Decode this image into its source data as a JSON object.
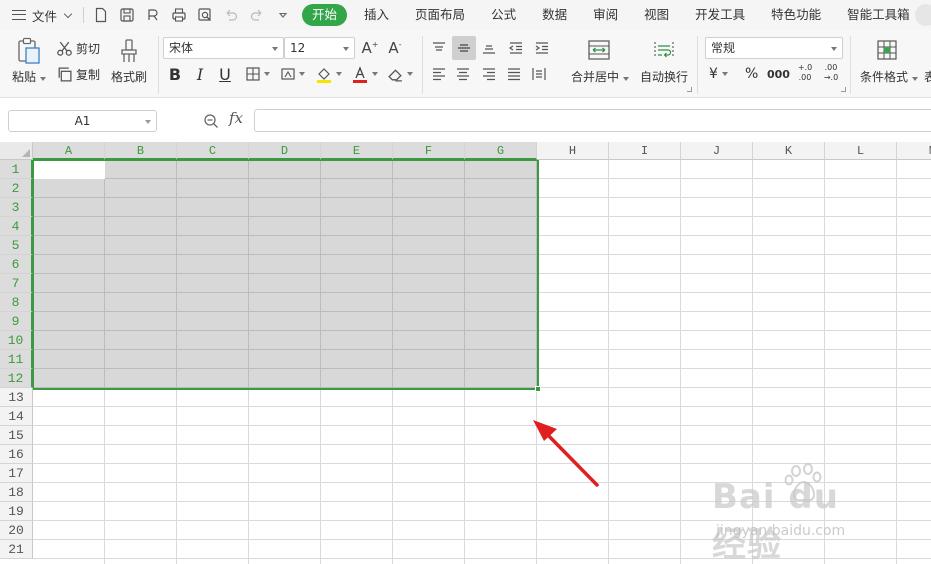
{
  "menu": {
    "file_label": "文件",
    "tabs": [
      {
        "label": "开始",
        "active": true
      },
      {
        "label": "插入"
      },
      {
        "label": "页面布局"
      },
      {
        "label": "公式"
      },
      {
        "label": "数据"
      },
      {
        "label": "审阅"
      },
      {
        "label": "视图"
      },
      {
        "label": "开发工具"
      },
      {
        "label": "特色功能"
      },
      {
        "label": "智能工具箱"
      }
    ]
  },
  "ribbon": {
    "paste": "粘贴",
    "cut": "剪切",
    "copy": "复制",
    "format_painter": "格式刷",
    "font_name": "宋体",
    "font_size": "12",
    "bold": "B",
    "italic": "I",
    "underline": "U",
    "merge_center": "合并居中",
    "wrap_text": "自动换行",
    "number_format": "常规",
    "currency": "¥",
    "percent": "%",
    "thousands": "000",
    "inc_decimal": "+.0 .00",
    "dec_decimal": ".00 →.0",
    "conditional_format": "条件格式",
    "truncated_next": "表"
  },
  "formula_bar": {
    "name_box": "A1",
    "fx": "fx",
    "formula": ""
  },
  "grid": {
    "columns": [
      "A",
      "B",
      "C",
      "D",
      "E",
      "F",
      "G",
      "H",
      "I",
      "J",
      "K",
      "L",
      "M"
    ],
    "rows": [
      "1",
      "2",
      "3",
      "4",
      "5",
      "6",
      "7",
      "8",
      "9",
      "10",
      "11",
      "12",
      "13",
      "14",
      "15",
      "16",
      "17",
      "18",
      "19",
      "20",
      "21"
    ],
    "selection": "A1:G12"
  },
  "watermark": {
    "brand": "Bai du 经验",
    "url": "jingyan.baidu.com"
  },
  "colors": {
    "accent": "#33a64a",
    "selection_border": "#3a9a3f",
    "selection_fill": "#d8d8d8",
    "arrow": "#e02020"
  }
}
